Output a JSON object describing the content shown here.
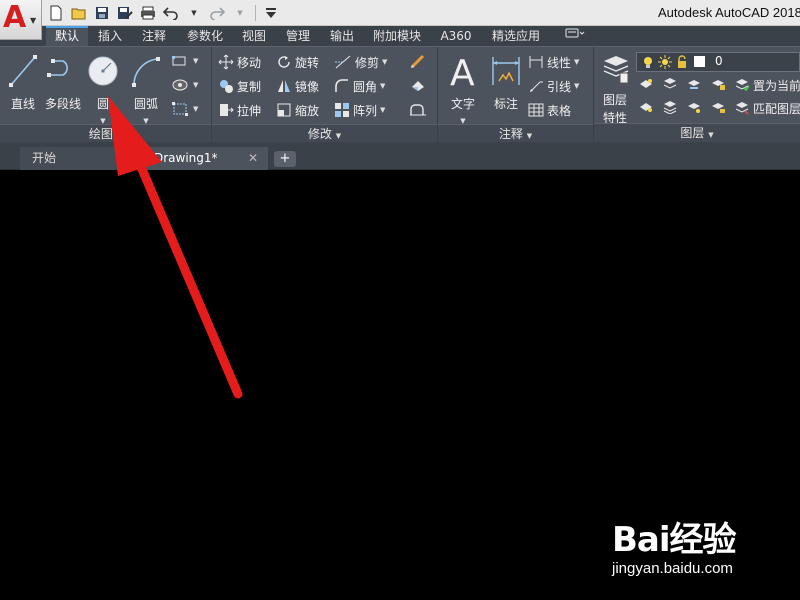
{
  "titlebar": {
    "title": "Autodesk AutoCAD 2018",
    "app_logo_letter": "A"
  },
  "quick_access": [
    "new-icon",
    "open-icon",
    "save-icon",
    "save-as-icon",
    "plot-icon",
    "undo-icon",
    "redo-icon",
    "customize-icon"
  ],
  "ribbon_tabs": [
    {
      "label": "默认",
      "active": true
    },
    {
      "label": "插入"
    },
    {
      "label": "注释"
    },
    {
      "label": "参数化"
    },
    {
      "label": "视图"
    },
    {
      "label": "管理"
    },
    {
      "label": "输出"
    },
    {
      "label": "附加模块"
    },
    {
      "label": "A360"
    },
    {
      "label": "精选应用"
    }
  ],
  "ribbon": {
    "draw": {
      "footer": "绘图",
      "line": "直线",
      "polyline": "多段线",
      "circle": "圆",
      "arc": "圆弧"
    },
    "modify": {
      "footer": "修改",
      "move": "移动",
      "rotate": "旋转",
      "trim": "修剪",
      "copy": "复制",
      "mirror": "镜像",
      "fillet": "圆角",
      "stretch": "拉伸",
      "scale": "缩放",
      "array": "阵列"
    },
    "annotation": {
      "footer": "注释",
      "text": "文字",
      "dimension": "标注",
      "linear": "线性",
      "leader": "引线",
      "table": "表格"
    },
    "layers": {
      "footer": "图层",
      "layer_properties_line1": "图层",
      "layer_properties_line2": "特性",
      "current_layer": "0",
      "make_current": "置为当前",
      "match_layer": "匹配图层"
    }
  },
  "file_tabs": {
    "start": "开始",
    "drawing": "Drawing1*",
    "add": "+"
  },
  "watermark": {
    "logo": "Bai经验",
    "url": "jingyan.baidu.com"
  },
  "colors": {
    "accent_tab": "#49a2e8",
    "annotation_arrow": "#e51c1c",
    "autocad_red": "#d31f1f"
  }
}
